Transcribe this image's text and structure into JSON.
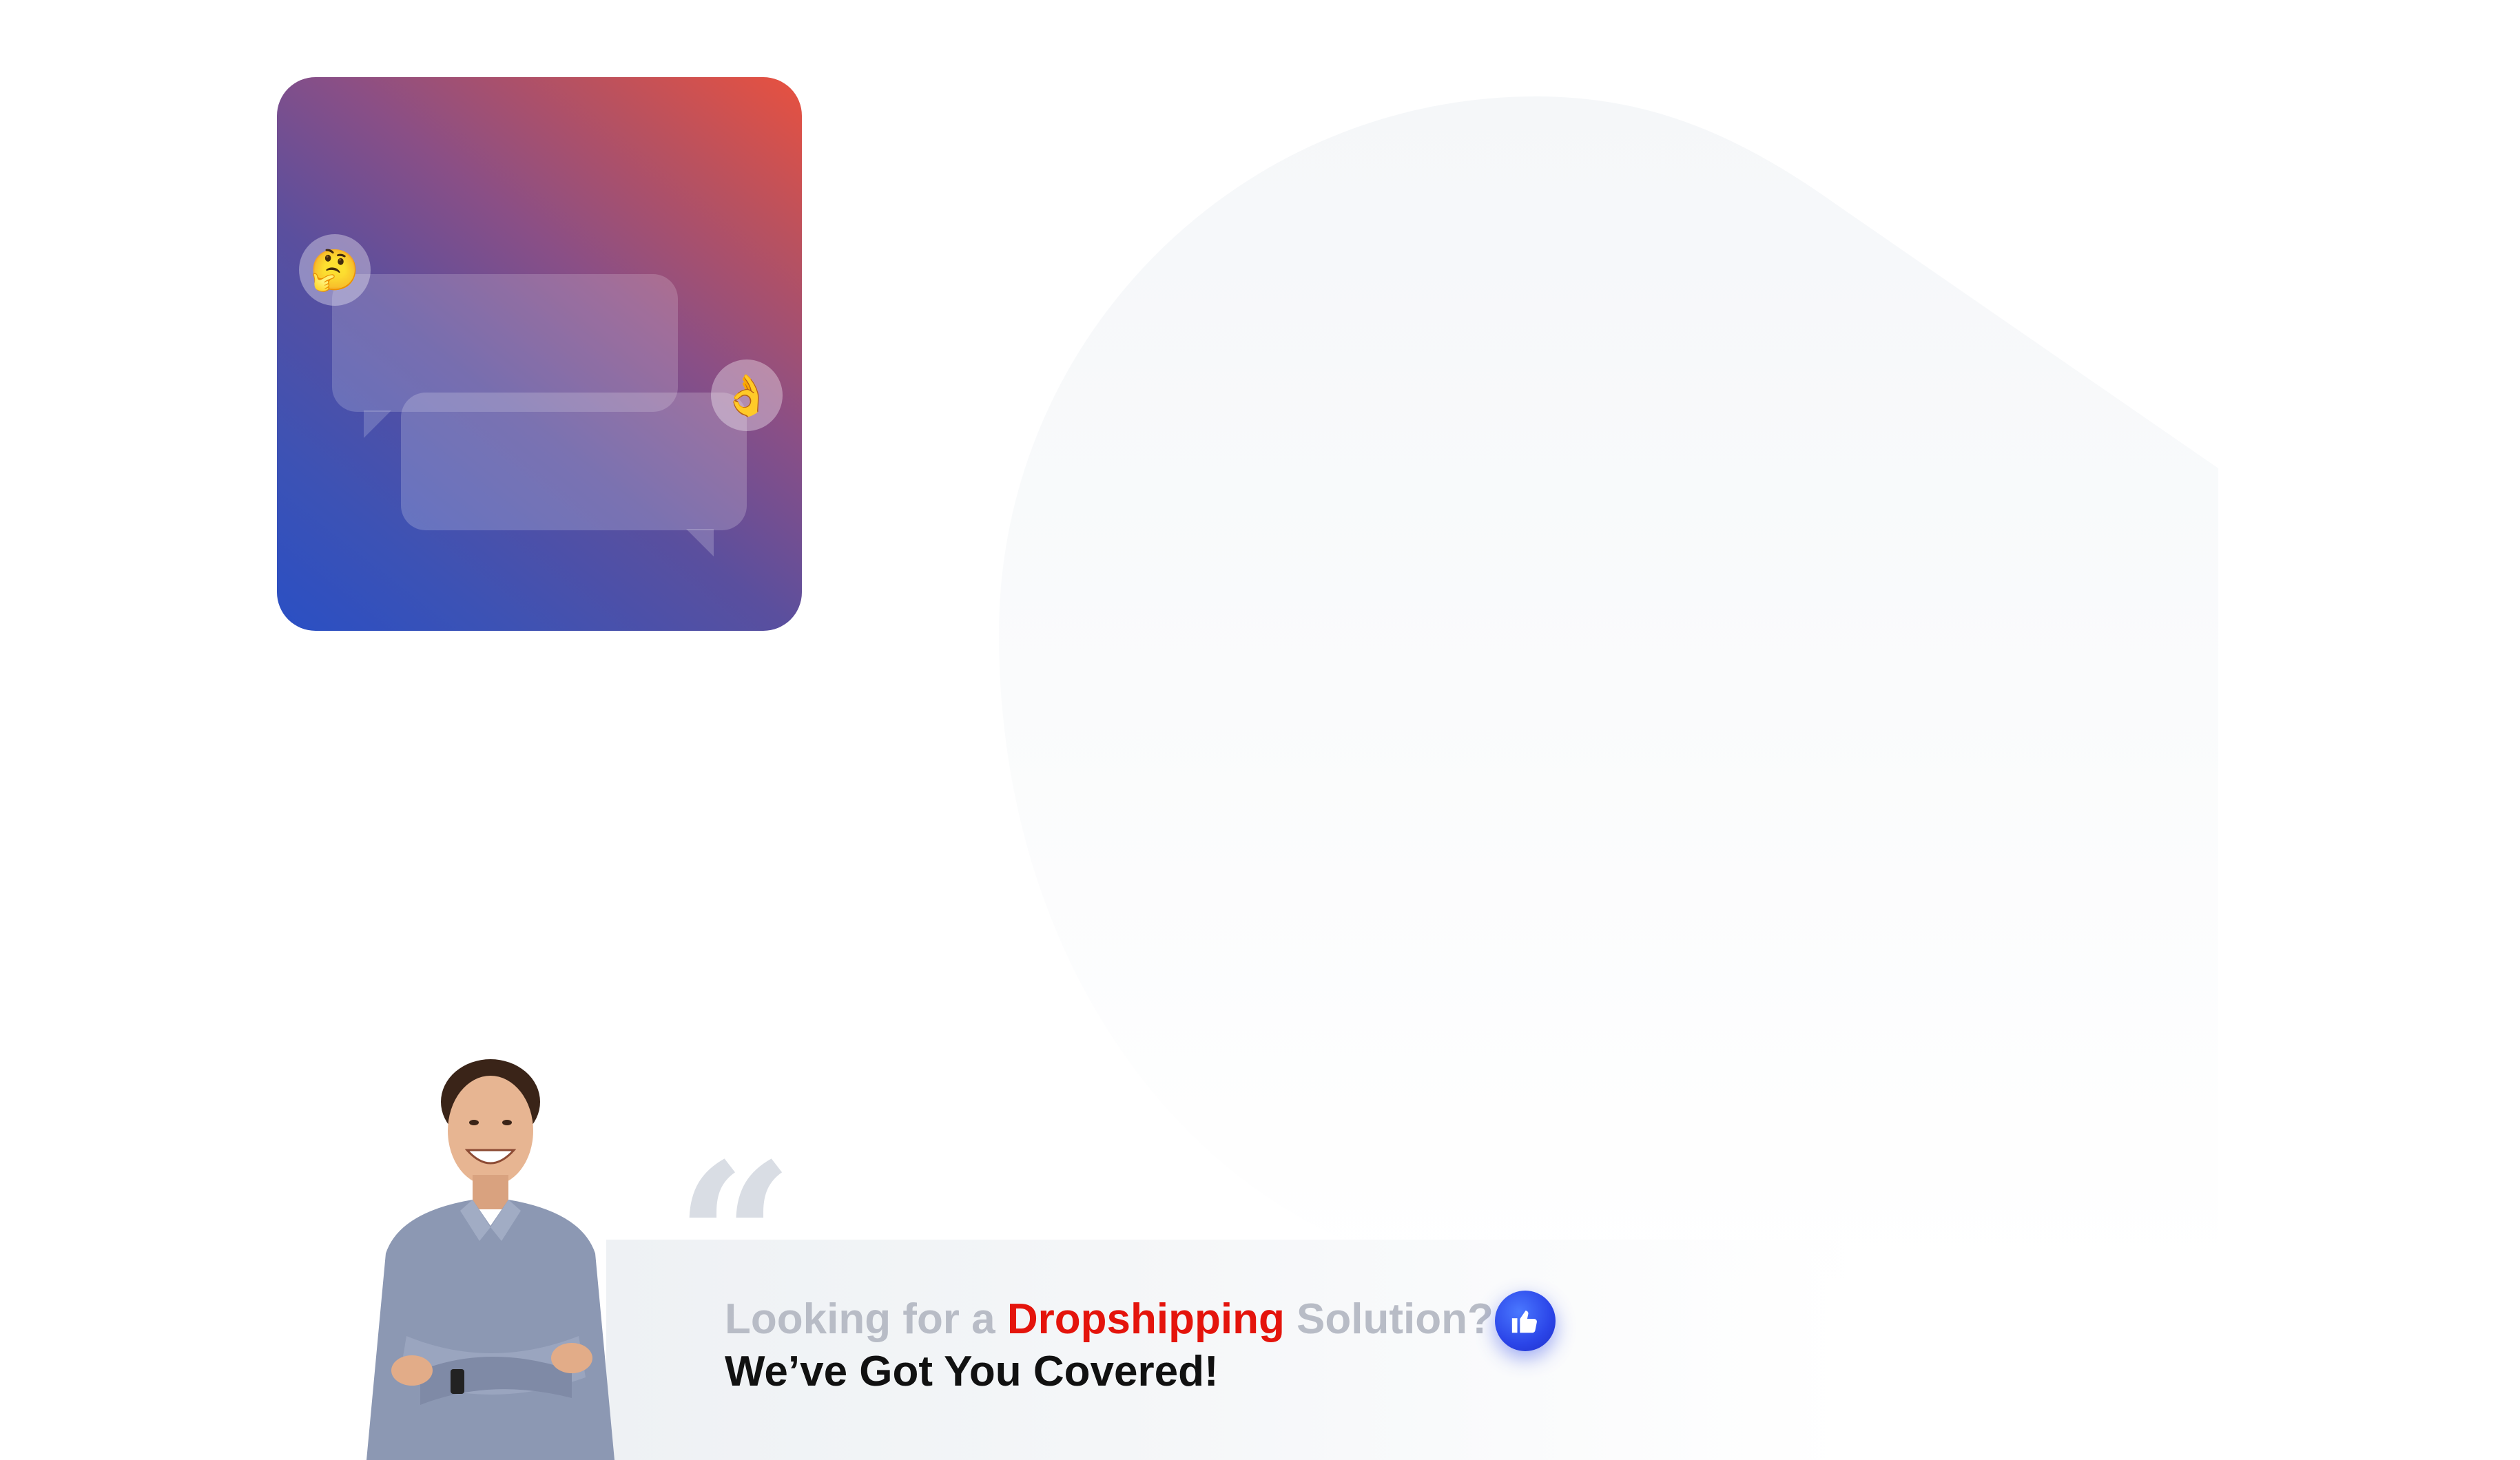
{
  "hero": {
    "chat_card": {
      "emoji_top_left": "🤔",
      "emoji_top_right": "👌",
      "gradient_start": "#2a4fc4",
      "gradient_end": "#e8513f"
    }
  },
  "banner": {
    "headline_prefix": "Looking for a ",
    "headline_accent": "Dropshipping",
    "headline_suffix": " Solution?",
    "subheadline": "We’ve Got You Covered!",
    "quote_mark": "“",
    "accent_color": "#e4140c",
    "like_icon": "thumbs-up-icon"
  }
}
